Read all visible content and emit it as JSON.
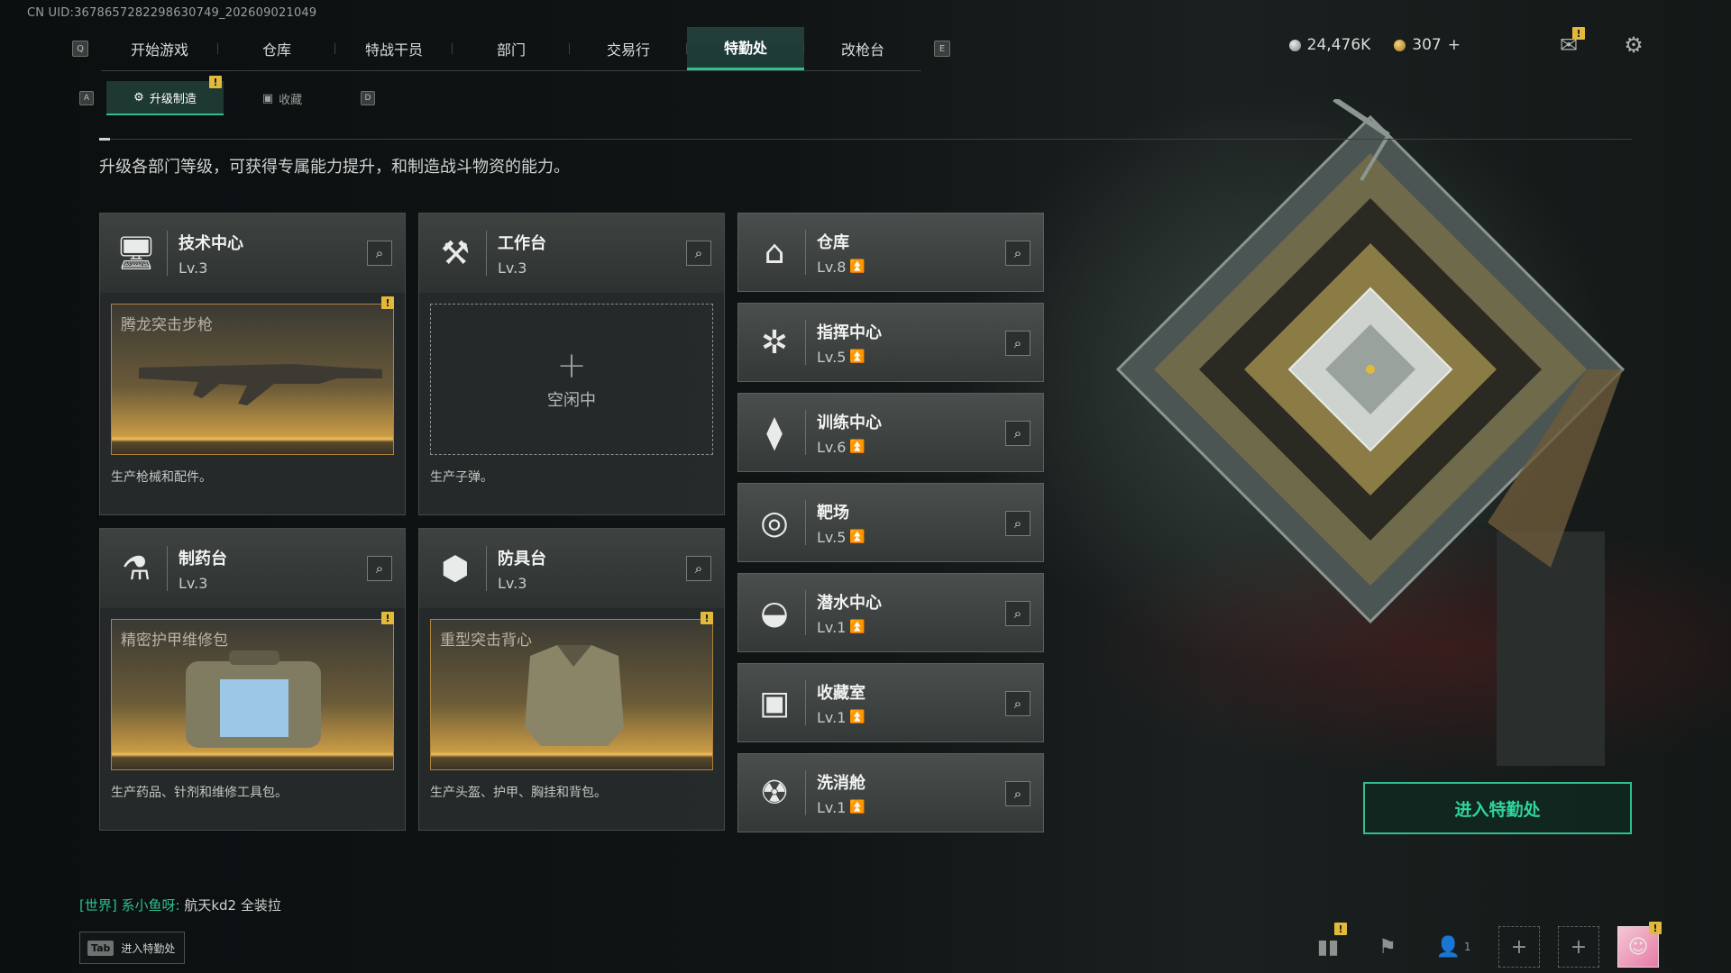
{
  "uid": "CN UID:3678657282298630749_202609021049",
  "nav": {
    "left_key": "Q",
    "right_key": "E",
    "tabs": [
      "开始游戏",
      "仓库",
      "特战干员",
      "部门",
      "交易行",
      "特勤处",
      "改枪台"
    ],
    "active": "特勤处"
  },
  "currency": {
    "coins": "24,476K",
    "bonds": "307",
    "plus": "+"
  },
  "subnav": {
    "left_key": "A",
    "right_key": "D",
    "tabs": [
      "升级制造",
      "收藏"
    ]
  },
  "description": "升级各部门等级，可获得专属能力提升，和制造战斗物资的能力。",
  "production": [
    {
      "name": "技术中心",
      "level": "Lv.3",
      "icon": "tech-center-icon",
      "slot_item": "腾龙突击步枪",
      "produce": "生产枪械和配件。"
    },
    {
      "name": "工作台",
      "level": "Lv.3",
      "icon": "workbench-icon",
      "slot_idle": "空闲中",
      "produce": "生产子弹。"
    },
    {
      "name": "制药台",
      "level": "Lv.3",
      "icon": "pharmacy-icon",
      "slot_item": "精密护甲维修包",
      "produce": "生产药品、针剂和维修工具包。"
    },
    {
      "name": "防具台",
      "level": "Lv.3",
      "icon": "armor-bench-icon",
      "slot_item": "重型突击背心",
      "produce": "生产头盔、护甲、胸挂和背包。"
    }
  ],
  "departments": [
    {
      "name": "仓库",
      "level": "Lv.8",
      "icon": "warehouse-icon"
    },
    {
      "name": "指挥中心",
      "level": "Lv.5",
      "icon": "command-center-icon"
    },
    {
      "name": "训练中心",
      "level": "Lv.6",
      "icon": "dumbbell-icon"
    },
    {
      "name": "靶场",
      "level": "Lv.5",
      "icon": "target-icon"
    },
    {
      "name": "潜水中心",
      "level": "Lv.1",
      "icon": "diving-mask-icon"
    },
    {
      "name": "收藏室",
      "level": "Lv.1",
      "icon": "collection-room-icon"
    },
    {
      "name": "洗消舱",
      "level": "Lv.1",
      "icon": "decon-chamber-icon"
    }
  ],
  "enter_button": "进入特勤处",
  "chat": {
    "channel": "[世界]",
    "user": "系小鱼呀:",
    "message": "航天kd2 全装拉"
  },
  "tab_hint": {
    "key": "Tab",
    "label": "进入特勤处"
  },
  "bottom": {
    "friends_count": "1"
  },
  "notif_mark": "!",
  "colors": {
    "accent": "#2fbf8e",
    "notify": "#e2b93a",
    "upgrade": "#e2b93a"
  }
}
